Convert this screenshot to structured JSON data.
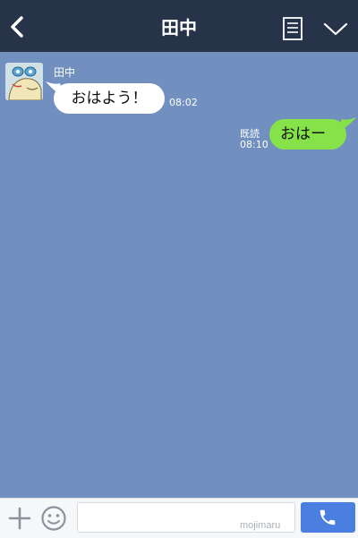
{
  "header": {
    "title": "田中",
    "back_icon": "chevron-left-icon",
    "menu_icon": "notes-icon",
    "dropdown_icon": "chevron-down-icon"
  },
  "messages": [
    {
      "direction": "incoming",
      "sender": "田中",
      "text": "おはよう！",
      "time": "08:02"
    },
    {
      "direction": "outgoing",
      "text": "おはー",
      "read_status": "既読",
      "time": "08:10"
    }
  ],
  "composer": {
    "input_value": "",
    "watermark": "mojimaru",
    "plus_icon": "plus-icon",
    "emoji_icon": "emoji-icon",
    "call_icon": "phone-icon"
  },
  "colors": {
    "header_bg": "#273348",
    "chat_bg": "#7190bf",
    "incoming_bubble": "#ffffff",
    "outgoing_bubble": "#85e249",
    "call_button": "#4a7fe0"
  }
}
